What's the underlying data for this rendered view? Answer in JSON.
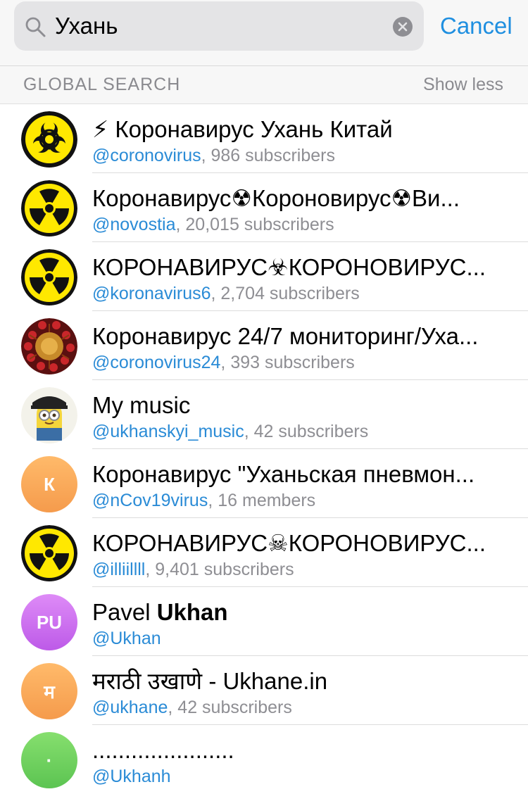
{
  "search": {
    "query": "Ухань",
    "cancel_label": "Cancel"
  },
  "section": {
    "title": "GLOBAL SEARCH",
    "action": "Show less"
  },
  "results": [
    {
      "title": "⚡ Коронавирус Ухань Китай",
      "username": "@coronovirus",
      "meta": ", 986 subscribers",
      "avatar": "biohazard-icon"
    },
    {
      "title": "Коронавирус☢Короновирус☢Ви...",
      "username": "@novostia",
      "meta": ", 20,015 subscribers",
      "avatar": "radiation-icon"
    },
    {
      "title": "КОРОНАВИРУС☣КОРОНОВИРУС...",
      "username": "@koronavirus6",
      "meta": ", 2,704 subscribers",
      "avatar": "radiation-icon"
    },
    {
      "title": "Коронавирус 24/7 мониторинг/Уха...",
      "username": "@coronovirus24",
      "meta": ", 393 subscribers",
      "avatar": "virus-icon"
    },
    {
      "title": "My music",
      "username": "@ukhanskyi_music",
      "meta": ", 42 subscribers",
      "avatar": "minion-icon"
    },
    {
      "title": "Коронавирус \"Уханьская пневмон...",
      "username": "@nCov19virus",
      "meta": ", 16 members",
      "avatar_letter": "К",
      "avatar_color": "#f7a35a"
    },
    {
      "title": "КОРОНАВИРУС☠КОРОНОВИРУС...",
      "username": "@illiillll",
      "meta": ", 9,401 subscribers",
      "avatar": "radiation-icon"
    },
    {
      "title_prefix": "Pavel ",
      "title_bold": "Ukhan",
      "username": "@Ukhan",
      "meta": "",
      "avatar_letter": "PU",
      "avatar_color": "#c46cf0"
    },
    {
      "title": "मराठी उखाणे - Ukhane.in",
      "username": "@ukhane",
      "meta": ", 42 subscribers",
      "avatar_letter": "म",
      "avatar_color": "#f7a35a"
    },
    {
      "title": "......................",
      "username": "@Ukhanh",
      "meta": "",
      "avatar_letter": "·",
      "avatar_color": "#6fcf5a"
    }
  ],
  "colors": {
    "accent": "#1f8fe0",
    "link": "#2a8bd6",
    "muted": "#8e8e93"
  }
}
